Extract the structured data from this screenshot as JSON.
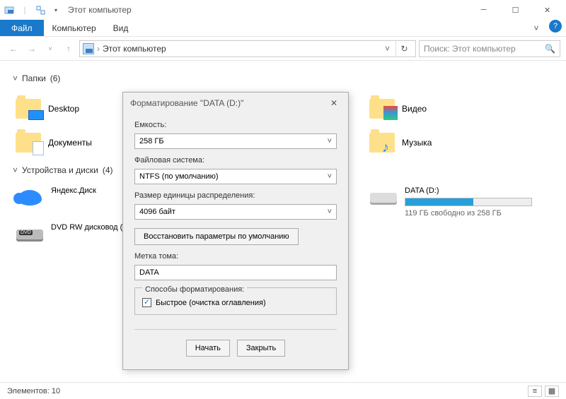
{
  "titlebar": {
    "title": "Этот компьютер"
  },
  "ribbon": {
    "file": "Файл",
    "computer": "Компьютер",
    "view": "Вид"
  },
  "nav": {
    "breadcrumb": "Этот компьютер",
    "search_placeholder": "Поиск: Этот компьютер"
  },
  "groups": {
    "folders": {
      "title": "Папки",
      "count": "(6)",
      "items": [
        {
          "label": "Desktop",
          "overlay": "monitor"
        },
        {
          "label": "Документы",
          "overlay": "doc"
        },
        {
          "label": "Видео",
          "overlay": "video"
        },
        {
          "label": "Музыка",
          "overlay": "music"
        }
      ]
    },
    "devices": {
      "title": "Устройства и диски",
      "count": "(4)",
      "items": [
        {
          "label": "Яндекс.Диск",
          "kind": "yadisk"
        },
        {
          "label": "DVD RW дисковод (",
          "kind": "dvd"
        },
        {
          "label": "DATA (D:)",
          "kind": "hdd",
          "sub": "119 ГБ свободно из 258 ГБ",
          "fill": 54
        }
      ]
    }
  },
  "status": {
    "items_label": "Элементов:",
    "items_count": "10"
  },
  "dialog": {
    "title": "Форматирование \"DATA (D:)\"",
    "capacity_label": "Емкость:",
    "capacity_value": "258 ГБ",
    "fs_label": "Файловая система:",
    "fs_value": "NTFS (по умолчанию)",
    "alloc_label": "Размер единицы распределения:",
    "alloc_value": "4096 байт",
    "restore_defaults": "Восстановить параметры по умолчанию",
    "volume_label": "Метка тома:",
    "volume_value": "DATA",
    "options_legend": "Способы форматирования:",
    "quick_label": "Быстрое (очистка оглавления)",
    "start": "Начать",
    "close": "Закрыть"
  }
}
